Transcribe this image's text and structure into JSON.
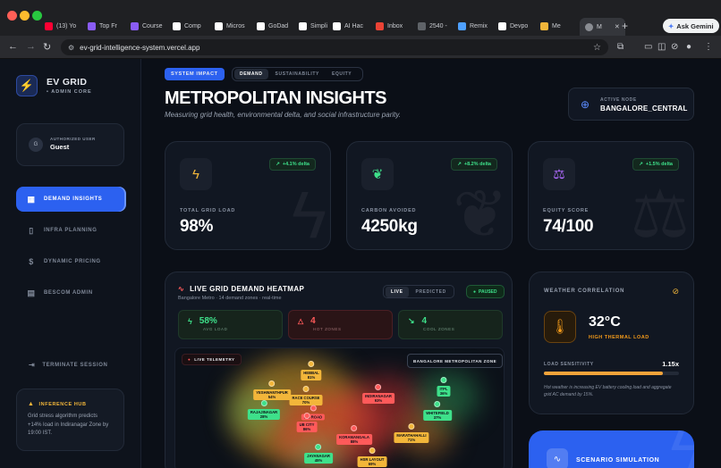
{
  "browser": {
    "tabs": [
      {
        "label": "(13) Yo",
        "color": "#ff0033"
      },
      {
        "label": "Top Fr",
        "color": "#8a5cf6"
      },
      {
        "label": "Course",
        "color": "#8a5cf6"
      },
      {
        "label": "Comp",
        "color": "#ffffff"
      },
      {
        "label": "Micros",
        "color": "#ffffff"
      },
      {
        "label": "GoDad",
        "color": "#ffffff"
      },
      {
        "label": "Simpli",
        "color": "#ffffff"
      },
      {
        "label": "AI Hac",
        "color": "#ffffff"
      },
      {
        "label": "Inbox",
        "color": "#ea4335"
      },
      {
        "label": "2540 -",
        "color": "#5f6368"
      },
      {
        "label": "Remix",
        "color": "#4ea0ff"
      },
      {
        "label": "Devpo",
        "color": "#ffffff"
      },
      {
        "label": "Me",
        "color": "#f2b63a"
      }
    ],
    "active_tab": "M",
    "new_tab": "+",
    "ask_gemini": "Ask Gemini",
    "url": "ev-grid-intelligence-system.vercel.app"
  },
  "sidebar": {
    "brand_title": "EV GRID",
    "brand_sub": "• ADMIN CORE",
    "user_caption": "AUTHORIZED USER",
    "user_name": "Guest",
    "avatar_initial": "G",
    "items": [
      {
        "label": "DEMAND INSIGHTS",
        "icon": "grid-icon",
        "active": true
      },
      {
        "label": "INFRA PLANNING",
        "icon": "map-icon",
        "active": false
      },
      {
        "label": "DYNAMIC PRICING",
        "icon": "dollar-icon",
        "active": false
      },
      {
        "label": "BESCOM ADMIN",
        "icon": "building-icon",
        "active": false
      }
    ],
    "terminate": "TERMINATE SESSION",
    "hub_title": "INFERENCE HUB",
    "hub_text": "Grid stress algorithm predicts +14% load in Indiranagar Zone by 19:00 IST."
  },
  "header": {
    "impact_label": "SYSTEM IMPACT",
    "segments": [
      "DEMAND",
      "SUSTAINABILITY",
      "EQUITY"
    ],
    "title": "METROPOLITAN INSIGHTS",
    "subtitle": "Measuring grid health, environmental delta, and social infrastructure parity.",
    "node_caption": "ACTIVE NODE",
    "node_value": "BANGALORE_CENTRAL"
  },
  "stats": [
    {
      "label": "TOTAL GRID LOAD",
      "value": "98%",
      "delta": "+4.1% delta",
      "icon": "lightning-icon",
      "color": "#f2b63a"
    },
    {
      "label": "CARBON AVOIDED",
      "value": "4250kg",
      "delta": "+8.2% delta",
      "icon": "leaf-icon",
      "color": "#3ee08a"
    },
    {
      "label": "EQUITY SCORE",
      "value": "74/100",
      "delta": "+1.5% delta",
      "icon": "scale-icon",
      "color": "#b06bff"
    }
  ],
  "heatmap": {
    "title": "LIVE GRID DEMAND HEATMAP",
    "subtitle": "Bangalore Metro · 14 demand zones · real-time",
    "live": "LIVE",
    "predicted": "PREDICTED",
    "paused": "PAUSED",
    "kpis": [
      {
        "value": "58%",
        "label": "AVG LOAD",
        "color": "#3ee08a"
      },
      {
        "value": "4",
        "label": "HOT ZONES",
        "color": "#ff5a5a"
      },
      {
        "value": "4",
        "label": "COOL ZONES",
        "color": "#3ee08a"
      }
    ],
    "telemetry": "LIVE TELEMETRY",
    "zone_tag": "BANGALORE METROPOLITAN ZONE",
    "zones": [
      {
        "name": "HEBBAL",
        "load": "81%",
        "color": "#f2b63a"
      },
      {
        "name": "YESHWANTHPUR",
        "load": "54%",
        "color": "#f2b63a"
      },
      {
        "name": "RACE COURSE",
        "load": "70%",
        "color": "#f2b63a"
      },
      {
        "name": "RAJAJINAGAR",
        "load": "28%",
        "color": "#3ee08a"
      },
      {
        "name": "MG ROAD",
        "load": "",
        "color": "#ff5a5a"
      },
      {
        "name": "UB CITY",
        "load": "86%",
        "color": "#ff5a5a"
      },
      {
        "name": "INDIRANAGAR",
        "load": "93%",
        "color": "#ff5a5a"
      },
      {
        "name": "ITPL",
        "load": "36%",
        "color": "#3ee08a"
      },
      {
        "name": "WHITEFIELD",
        "load": "37%",
        "color": "#3ee08a"
      },
      {
        "name": "MARATHAHALLI",
        "load": "71%",
        "color": "#f2b63a"
      },
      {
        "name": "KORAMANGALA",
        "load": "88%",
        "color": "#ff5a5a"
      },
      {
        "name": "JAYANAGAR",
        "load": "45%",
        "color": "#3ee08a"
      },
      {
        "name": "HSR LAYOUT",
        "load": "69%",
        "color": "#f2b63a"
      }
    ]
  },
  "weather": {
    "title": "WEATHER CORRELATION",
    "temp": "32°C",
    "temp_label": "HIGH THERMAL LOAD",
    "sens_label": "LOAD SENSITIVITY",
    "sens_value": "1.15x",
    "sens_fraction": 0.88,
    "note": "Hot weather is increasing EV battery cooling load and aggregate grid AC demand by 15%."
  },
  "scenario": {
    "label": "SCENARIO SIMULATION"
  }
}
